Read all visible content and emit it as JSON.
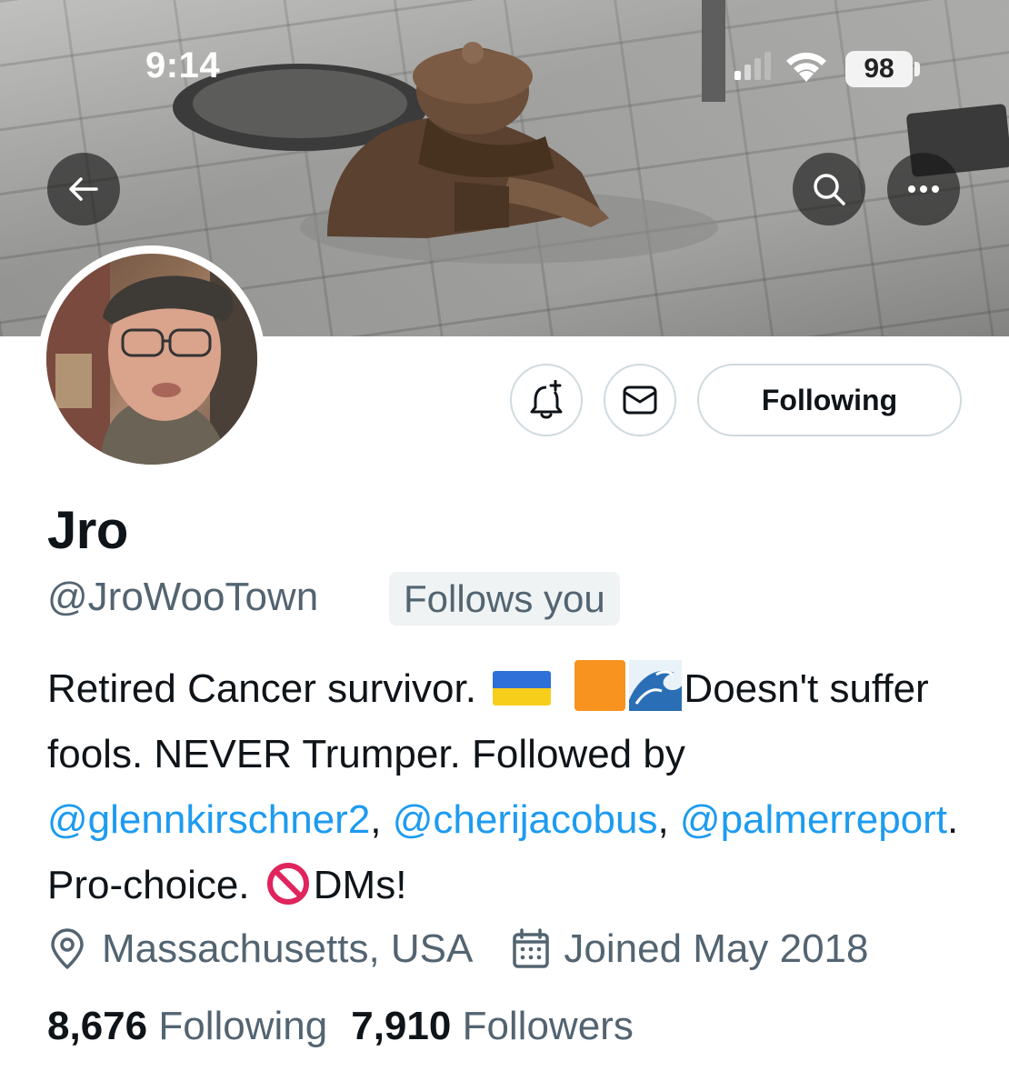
{
  "status_bar": {
    "time": "9:14",
    "battery": "98"
  },
  "banner": {
    "description_icon": "banner-image",
    "back_icon": "arrow-left-icon",
    "search_icon": "search-icon",
    "more_icon": "more-icon"
  },
  "actions": {
    "notify_icon": "bell-plus-icon",
    "message_icon": "envelope-icon",
    "following_label": "Following"
  },
  "profile": {
    "name": "Jro",
    "handle": "@JroWooTown",
    "follows_badge": "Follows you",
    "bio": {
      "part1": "Retired Cancer survivor.",
      "part2": "Doesn't suffer fools. NEVER Trumper. Followed by",
      "link1": "@glennkirschner2",
      "sep1": ", ",
      "link2": "@cherijacobus",
      "sep2": ",",
      "link3": "@palmerreport",
      "part3": ". Pro-choice.",
      "part4": "DMs!"
    },
    "location": "Massachusetts, USA",
    "joined": "Joined May 2018",
    "following_count": "8,676",
    "following_label": "Following",
    "followers_count": "7,910",
    "followers_label": "Followers"
  },
  "colors": {
    "link": "#1d9bf0",
    "muted": "#536471",
    "text": "#0f1419",
    "border": "#cfd9de"
  }
}
